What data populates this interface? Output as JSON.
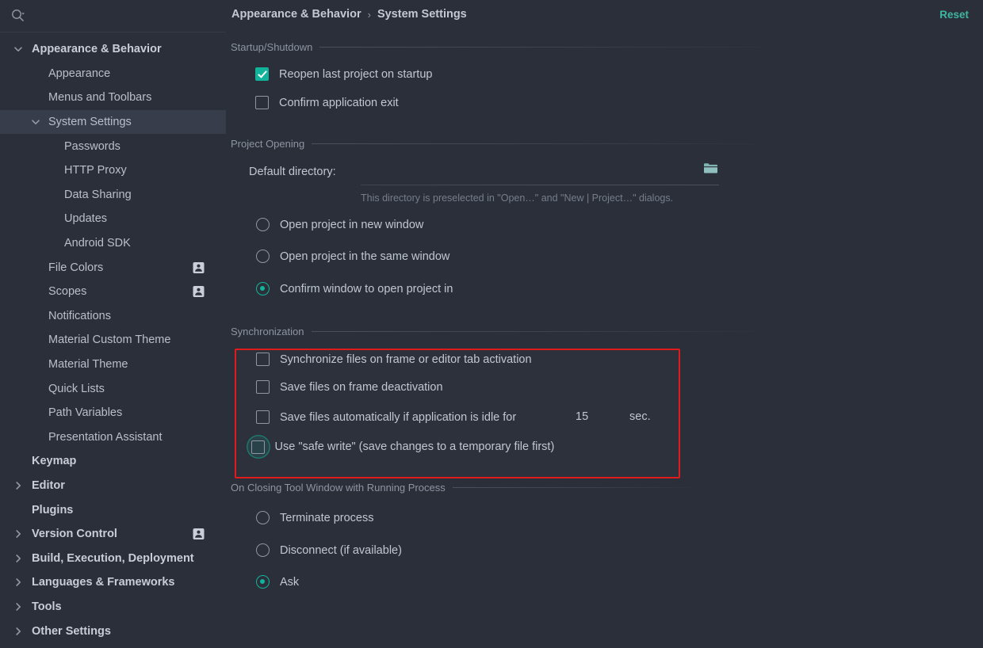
{
  "search": {
    "placeholder": "",
    "value": "",
    "icon": "search-icon"
  },
  "sidebar": {
    "items": [
      {
        "label": "Appearance & Behavior",
        "level": 0,
        "chevron": "chevron-down-icon",
        "bold": true,
        "selected": false,
        "badge": false
      },
      {
        "label": "Appearance",
        "level": 1,
        "chevron": "",
        "bold": false,
        "selected": false,
        "badge": false
      },
      {
        "label": "Menus and Toolbars",
        "level": 1,
        "chevron": "",
        "bold": false,
        "selected": false,
        "badge": false
      },
      {
        "label": "System Settings",
        "level": 1,
        "chevron": "chevron-down-icon",
        "bold": false,
        "selected": true,
        "badge": false
      },
      {
        "label": "Passwords",
        "level": 2,
        "chevron": "",
        "bold": false,
        "selected": false,
        "badge": false
      },
      {
        "label": "HTTP Proxy",
        "level": 2,
        "chevron": "",
        "bold": false,
        "selected": false,
        "badge": false
      },
      {
        "label": "Data Sharing",
        "level": 2,
        "chevron": "",
        "bold": false,
        "selected": false,
        "badge": false
      },
      {
        "label": "Updates",
        "level": 2,
        "chevron": "",
        "bold": false,
        "selected": false,
        "badge": false
      },
      {
        "label": "Android SDK",
        "level": 2,
        "chevron": "",
        "bold": false,
        "selected": false,
        "badge": false
      },
      {
        "label": "File Colors",
        "level": 1,
        "chevron": "",
        "bold": false,
        "selected": false,
        "badge": true
      },
      {
        "label": "Scopes",
        "level": 1,
        "chevron": "",
        "bold": false,
        "selected": false,
        "badge": true
      },
      {
        "label": "Notifications",
        "level": 1,
        "chevron": "",
        "bold": false,
        "selected": false,
        "badge": false
      },
      {
        "label": "Material Custom Theme",
        "level": 1,
        "chevron": "",
        "bold": false,
        "selected": false,
        "badge": false
      },
      {
        "label": "Material Theme",
        "level": 1,
        "chevron": "",
        "bold": false,
        "selected": false,
        "badge": false
      },
      {
        "label": "Quick Lists",
        "level": 1,
        "chevron": "",
        "bold": false,
        "selected": false,
        "badge": false
      },
      {
        "label": "Path Variables",
        "level": 1,
        "chevron": "",
        "bold": false,
        "selected": false,
        "badge": false
      },
      {
        "label": "Presentation Assistant",
        "level": 1,
        "chevron": "",
        "bold": false,
        "selected": false,
        "badge": false
      },
      {
        "label": "Keymap",
        "level": 0,
        "chevron": "",
        "bold": true,
        "selected": false,
        "badge": false
      },
      {
        "label": "Editor",
        "level": 0,
        "chevron": "chevron-right-icon",
        "bold": true,
        "selected": false,
        "badge": false
      },
      {
        "label": "Plugins",
        "level": 0,
        "chevron": "",
        "bold": true,
        "selected": false,
        "badge": false
      },
      {
        "label": "Version Control",
        "level": 0,
        "chevron": "chevron-right-icon",
        "bold": true,
        "selected": false,
        "badge": true
      },
      {
        "label": "Build, Execution, Deployment",
        "level": 0,
        "chevron": "chevron-right-icon",
        "bold": true,
        "selected": false,
        "badge": false
      },
      {
        "label": "Languages & Frameworks",
        "level": 0,
        "chevron": "chevron-right-icon",
        "bold": true,
        "selected": false,
        "badge": false
      },
      {
        "label": "Tools",
        "level": 0,
        "chevron": "chevron-right-icon",
        "bold": true,
        "selected": false,
        "badge": false
      },
      {
        "label": "Other Settings",
        "level": 0,
        "chevron": "chevron-right-icon",
        "bold": true,
        "selected": false,
        "badge": false
      }
    ]
  },
  "header": {
    "breadcrumb_root": "Appearance & Behavior",
    "breadcrumb_separator": "›",
    "breadcrumb_current": "System Settings",
    "reset_label": "Reset"
  },
  "sections": {
    "startup": {
      "title": "Startup/Shutdown",
      "reopen_last_project": {
        "label": "Reopen last project on startup",
        "checked": true
      },
      "confirm_exit": {
        "label": "Confirm application exit",
        "checked": false
      }
    },
    "project_opening": {
      "title": "Project Opening",
      "default_directory_label": "Default directory:",
      "default_directory_value": "",
      "browse_icon": "folder-icon",
      "hint": "This directory is preselected in \"Open…\" and \"New | Project…\" dialogs.",
      "options": [
        {
          "label": "Open project in new window",
          "selected": false
        },
        {
          "label": "Open project in the same window",
          "selected": false
        },
        {
          "label": "Confirm window to open project in",
          "selected": true
        }
      ]
    },
    "synchronization": {
      "title": "Synchronization",
      "highlighted": true,
      "sync_on_activation": {
        "label": "Synchronize files on frame or editor tab activation",
        "checked": false
      },
      "save_on_deactivation": {
        "label": "Save files on frame deactivation",
        "checked": false
      },
      "save_if_idle": {
        "label": "Save files automatically if application is idle for",
        "checked": false,
        "value": "15",
        "unit": "sec."
      },
      "safe_write": {
        "label": "Use \"safe write\" (save changes to a temporary file first)",
        "checked": false,
        "hovered": true
      }
    },
    "closing_tool_window": {
      "title": "On Closing Tool Window with Running Process",
      "options": [
        {
          "label": "Terminate process",
          "selected": false
        },
        {
          "label": "Disconnect (if available)",
          "selected": false
        },
        {
          "label": "Ask",
          "selected": true
        }
      ]
    }
  },
  "colors": {
    "background": "#2b2f3a",
    "accent": "#12b39b",
    "reset_link": "#3fb6a0",
    "highlight_box": "#e01b1b",
    "selected_row": "#383d4b"
  }
}
